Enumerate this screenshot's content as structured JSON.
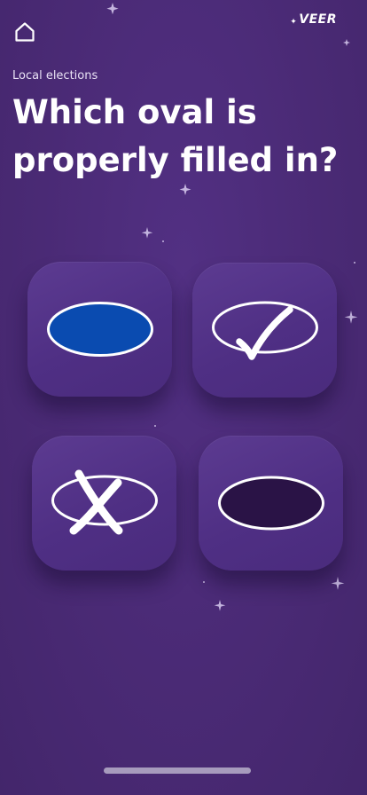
{
  "header": {
    "home_icon": "home-icon",
    "brand": "VEER"
  },
  "question": {
    "category": "Local elections",
    "text": "Which oval is properly filled in?"
  },
  "options": [
    {
      "id": "filled-blue-oval",
      "icon": "filled-oval-icon",
      "fill": "#0a4bb0"
    },
    {
      "id": "checkmark-oval",
      "icon": "checkmark-oval-icon"
    },
    {
      "id": "x-mark-oval",
      "icon": "x-mark-oval-icon"
    },
    {
      "id": "filled-dark-oval",
      "icon": "dark-filled-oval-icon",
      "fill": "#2a1346"
    }
  ],
  "colors": {
    "background": "#4a2a75",
    "card": "#553587",
    "accent_blue": "#0a4bb0",
    "home_indicator": "#a79bbd"
  }
}
